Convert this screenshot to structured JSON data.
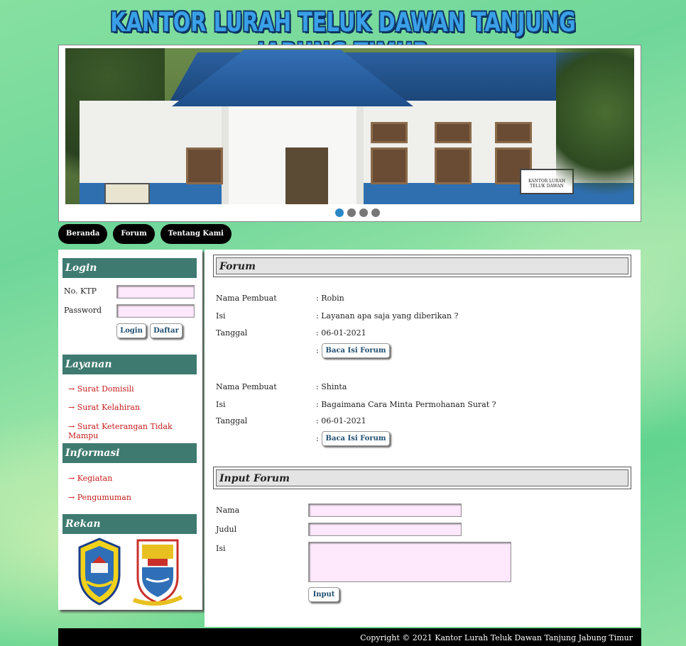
{
  "site": {
    "title": "KANTOR LURAH TELUK DAWAN TANJUNG JABUNG TIMUR"
  },
  "banner": {
    "sign_text": "KANTOR LURAH TELUK DAWAN",
    "slides_count": 4,
    "active_slide": 1
  },
  "nav": {
    "items": [
      "Beranda",
      "Forum",
      "Tentang Kami"
    ]
  },
  "sidebar": {
    "login": {
      "heading": "Login",
      "ktp_label": "No. KTP",
      "password_label": "Password",
      "login_button": "Login",
      "register_button": "Daftar"
    },
    "layanan": {
      "heading": "Layanan",
      "items": [
        "→ Surat Domisili",
        "→ Surat Kelahiran",
        "→ Surat Keterangan Tidak Mampu"
      ]
    },
    "informasi": {
      "heading": "Informasi",
      "items": [
        "→ Kegiatan",
        "→ Pengumuman"
      ]
    },
    "rekan": {
      "heading": "Rekan"
    }
  },
  "forum": {
    "heading": "Forum",
    "labels": {
      "author": "Nama Pembuat",
      "content": "Isi",
      "date": "Tanggal"
    },
    "posts": [
      {
        "author": ": Robin",
        "content": ": Layanan apa saja yang diberikan ?",
        "date": ": 06-01-2021",
        "button": "Baca Isi Forum"
      },
      {
        "author": ": Shinta",
        "content": ": Bagaimana Cara Minta Permohanan Surat ?",
        "date": ": 06-01-2021",
        "button": "Baca Isi Forum"
      }
    ],
    "colon": ":"
  },
  "input_forum": {
    "heading": "Input Forum",
    "name_label": "Nama",
    "title_label": "Judul",
    "content_label": "Isi",
    "submit_button": "Input"
  },
  "footer": {
    "text": "Copyright © 2021 Kantor Lurah Teluk Dawan Tanjung Jabung Timur"
  },
  "colors": {
    "side_heading_bg": "#3e7a70",
    "link_red": "#c61c1c",
    "input_bg": "#fde8fc",
    "button_text": "#1e4d6e"
  }
}
